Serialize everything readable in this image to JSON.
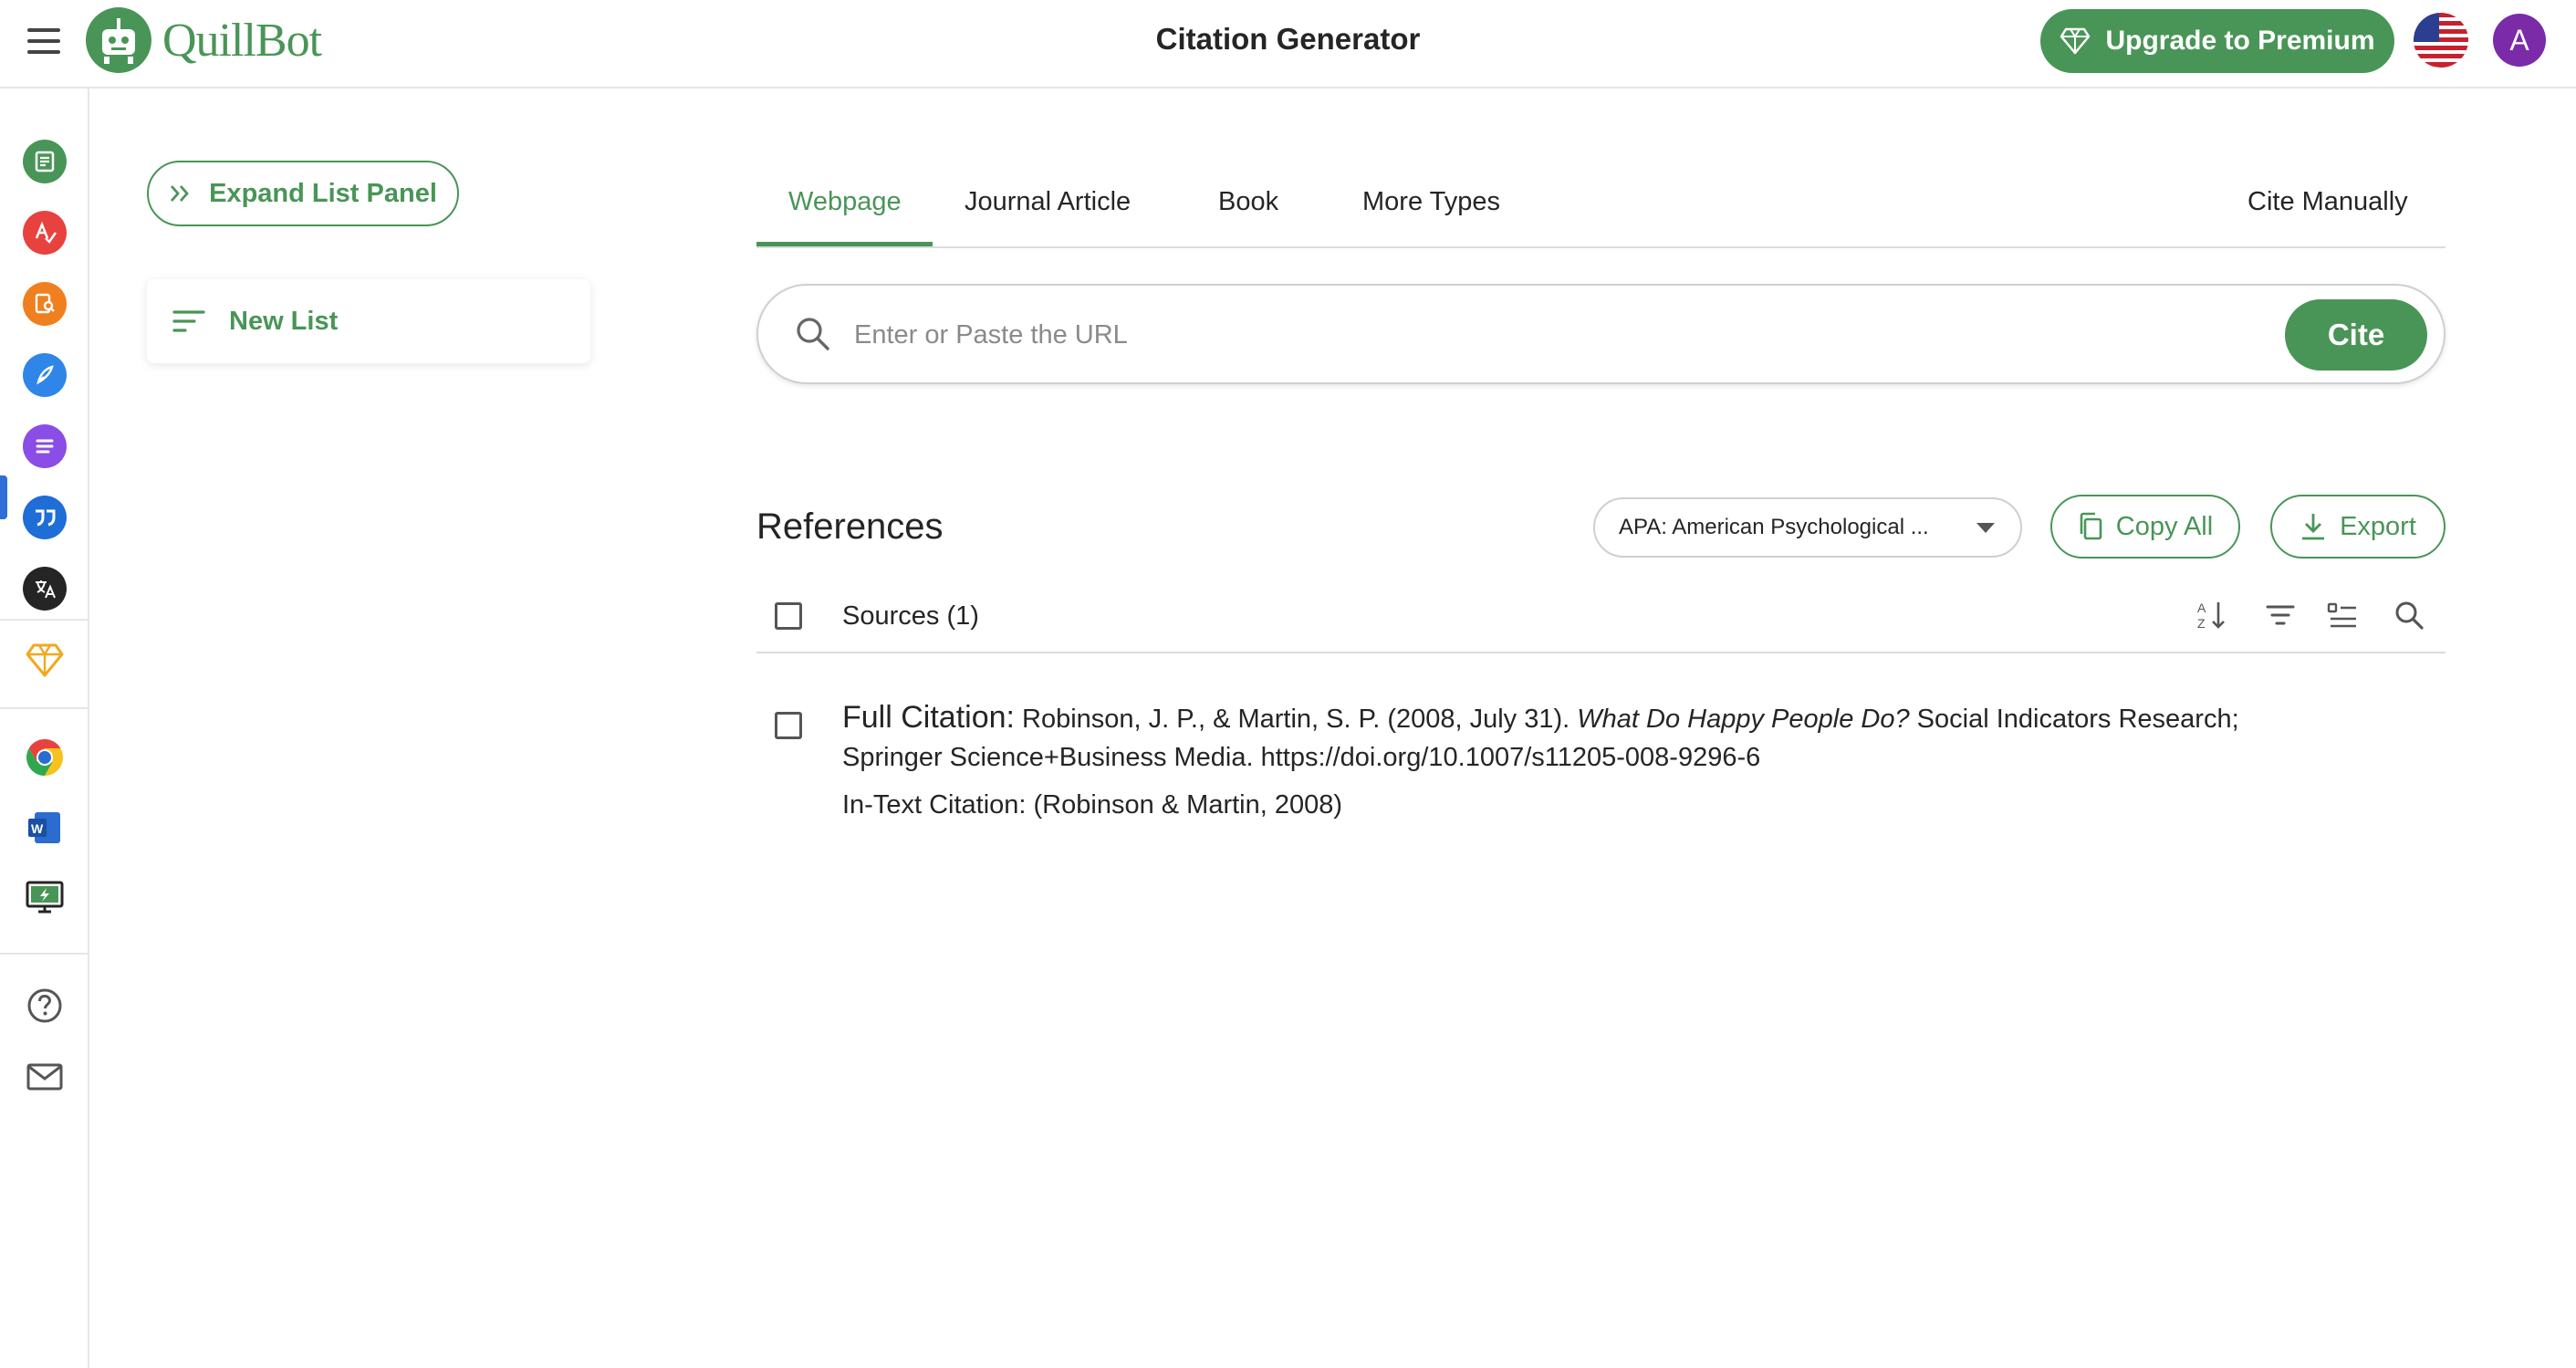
{
  "header": {
    "menu_icon": "hamburger-menu-icon",
    "logo_text": "QuillBot",
    "page_title": "Citation Generator",
    "premium_label": "Upgrade to Premium",
    "avatar_letter": "A",
    "brand_color": "#499557"
  },
  "rail": {
    "items": [
      {
        "icon": "paraphraser-icon",
        "color": "#499557"
      },
      {
        "icon": "grammar-checker-icon",
        "color": "#e8423f"
      },
      {
        "icon": "plagiarism-checker-icon",
        "color": "#f07f1f"
      },
      {
        "icon": "co-writer-icon",
        "color": "#2f86e8"
      },
      {
        "icon": "summarizer-icon",
        "color": "#8a4de6"
      },
      {
        "icon": "citation-generator-icon",
        "color": "#1f6dd6"
      },
      {
        "icon": "translator-icon",
        "color": "#252525"
      },
      {
        "icon": "premium-diamond-icon",
        "color": "#f0a81e"
      },
      {
        "icon": "chrome-extension-icon",
        "color": "#e8423f"
      },
      {
        "icon": "word-addin-icon",
        "color": "#2a6ccf"
      },
      {
        "icon": "desktop-app-icon",
        "color": "#499557"
      },
      {
        "icon": "help-icon",
        "color": "#555555"
      },
      {
        "icon": "mail-icon",
        "color": "#555555"
      }
    ]
  },
  "list_panel": {
    "expand_label": "Expand List Panel",
    "new_list_label": "New List"
  },
  "tabs": {
    "items": [
      "Webpage",
      "Journal Article",
      "Book",
      "More Types"
    ],
    "active": "Webpage",
    "cite_manually": "Cite Manually"
  },
  "search": {
    "placeholder": "Enter or Paste the URL",
    "cite_label": "Cite"
  },
  "references": {
    "title": "References",
    "style_selected": "APA: American Psychological ...",
    "copy_all_label": "Copy All",
    "export_label": "Export",
    "sources_label": "Sources (1)"
  },
  "citation": {
    "full_label": "Full Citation:",
    "authors_date": "Robinson, J. P., & Martin, S. P. (2008, July 31).",
    "title_italic": "What Do Happy People Do?",
    "rest": "Social Indicators Research; Springer Science+Business Media. https://doi.org/10.1007/s11205-008-9296-6",
    "in_text": "In-Text Citation: (Robinson & Martin, 2008)"
  }
}
